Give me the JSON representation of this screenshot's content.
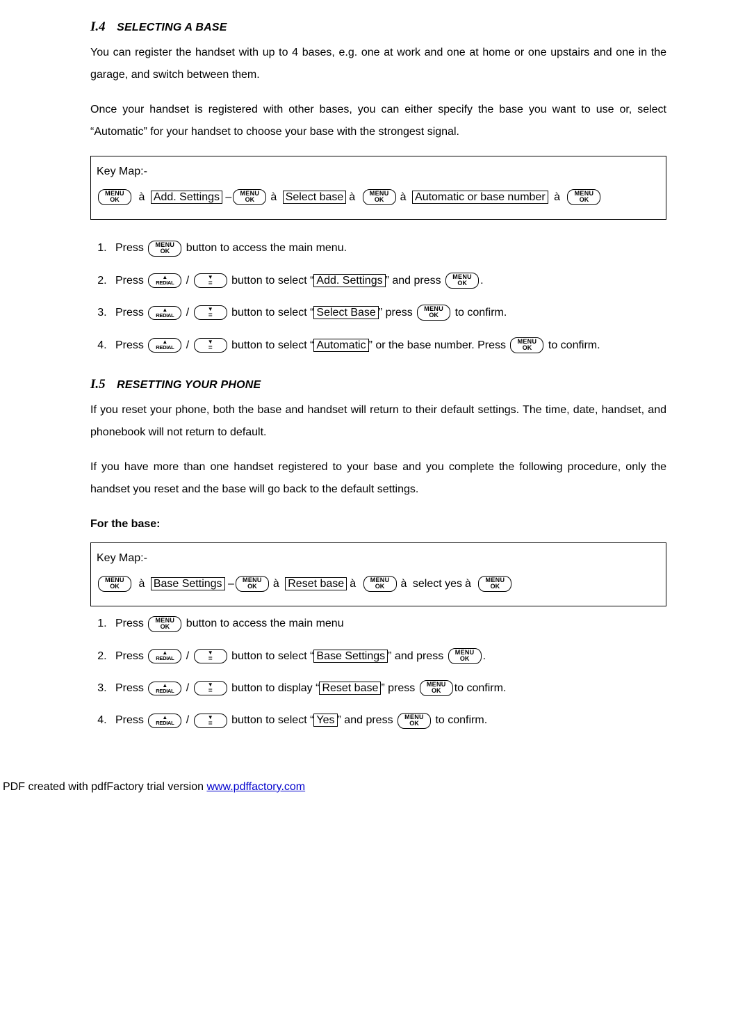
{
  "s14": {
    "num": "I.4",
    "title": "SELECTING A BASE",
    "p1": "You can register the handset with up to 4 bases, e.g. one at work and one at home or one upstairs and one in the garage, and switch between them.",
    "p2": "Once your handset is registered with other bases, you can either specify the base you want to use or, select “Automatic” for your handset to choose your base with the strongest signal."
  },
  "icons": {
    "menu_l1": "MENU",
    "menu_l2": "OK",
    "up_label": "REDIAL"
  },
  "keymap1": {
    "label": "Key Map:-",
    "opt1": "Add. Settings",
    "opt2": "Select base",
    "opt3": "Automatic or base number"
  },
  "arrow": "à",
  "dash": " –",
  "steps1": {
    "s1_a": "Press ",
    "s1_b": " button to access the main menu.",
    "s2_a": "Press ",
    "s2_b": " button to select “",
    "s2_opt": "Add. Settings",
    "s2_c": "” and press ",
    "s2_d": ".",
    "s3_a": "Press ",
    "s3_b": " button to select “",
    "s3_opt": "Select Base",
    "s3_c": "” press ",
    "s3_d": " to confirm.",
    "s4_a": "Press ",
    "s4_b": " button to select “",
    "s4_opt": "Automatic",
    "s4_c": "” or the base number. Press ",
    "s4_d": " to confirm."
  },
  "s15": {
    "num": "I.5",
    "title": "RESETTING YOUR PHONE",
    "p1": "If you reset your phone, both the base and handset will return to their default settings. The time, date, handset, and phonebook will not return to default.",
    "p2": "If you have more than one handset registered to your base and you complete the following procedure, only the handset you reset and the base will go back to the default settings.",
    "subhead": "For the base:"
  },
  "keymap2": {
    "label": "Key Map:-",
    "opt1": "Base Settings",
    "opt2": "Reset base",
    "opt3": "select yes"
  },
  "steps2": {
    "s1_a": "Press ",
    "s1_b": " button to access the main menu",
    "s2_a": "Press ",
    "s2_b": " button to select “",
    "s2_opt": "Base Settings",
    "s2_c": "” and press ",
    "s2_d": ".",
    "s3_a": "Press ",
    "s3_b": " button to display “",
    "s3_opt": "Reset base",
    "s3_c": "” press ",
    "s3_d": "to confirm.",
    "s4_a": "Press ",
    "s4_b": " button to select “",
    "s4_opt": "Yes",
    "s4_c": "” and press ",
    "s4_d": " to confirm."
  },
  "footer": {
    "prefix": "PDF created with pdfFactory trial version ",
    "link": "www.pdffactory.com"
  }
}
